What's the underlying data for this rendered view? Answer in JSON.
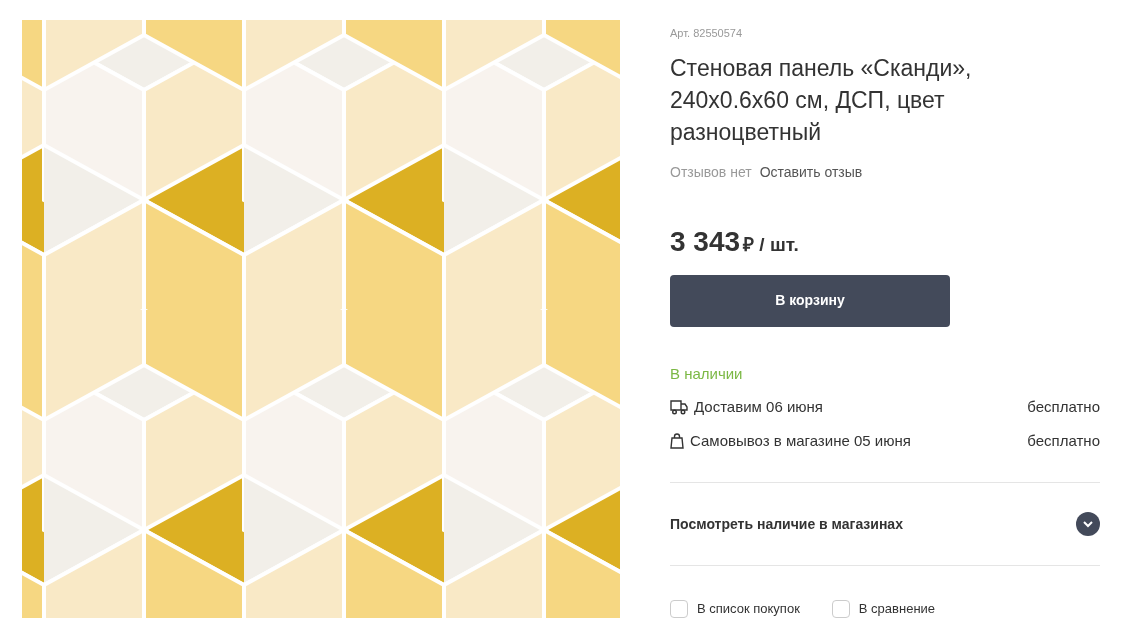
{
  "product": {
    "article": "Арт. 82550574",
    "title": "Стеновая панель «Сканди», 240x0.6x60 см, ДСП, цвет разноцветный",
    "reviews_count": "Отзывов нет",
    "review_link": "Оставить отзыв",
    "price": "3 343",
    "currency": "₽",
    "unit": "/ шт.",
    "cart_button": "В корзину"
  },
  "availability": {
    "status": "В наличии",
    "options": [
      {
        "kind": "delivery",
        "label": "Доставим 06 июня",
        "cost": "бесплатно"
      },
      {
        "kind": "pickup",
        "label": "Самовывоз в магазине 05 июня",
        "cost": "бесплатно"
      }
    ]
  },
  "stores_section": {
    "label": "Посмотреть наличие в магазинах",
    "expanded": false
  },
  "checkboxes": [
    {
      "label": "В список покупок",
      "checked": false
    },
    {
      "label": "В сравнение",
      "checked": false
    }
  ]
}
